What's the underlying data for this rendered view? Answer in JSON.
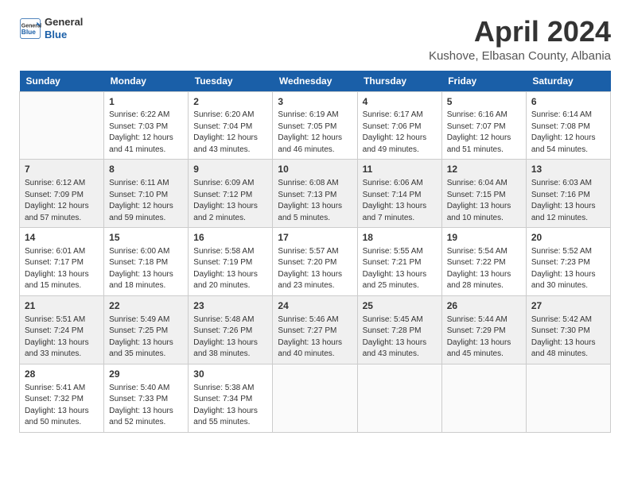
{
  "header": {
    "logo_line1": "General",
    "logo_line2": "Blue",
    "month_title": "April 2024",
    "subtitle": "Kushove, Elbasan County, Albania"
  },
  "weekdays": [
    "Sunday",
    "Monday",
    "Tuesday",
    "Wednesday",
    "Thursday",
    "Friday",
    "Saturday"
  ],
  "weeks": [
    [
      {
        "day": "",
        "info": ""
      },
      {
        "day": "1",
        "info": "Sunrise: 6:22 AM\nSunset: 7:03 PM\nDaylight: 12 hours\nand 41 minutes."
      },
      {
        "day": "2",
        "info": "Sunrise: 6:20 AM\nSunset: 7:04 PM\nDaylight: 12 hours\nand 43 minutes."
      },
      {
        "day": "3",
        "info": "Sunrise: 6:19 AM\nSunset: 7:05 PM\nDaylight: 12 hours\nand 46 minutes."
      },
      {
        "day": "4",
        "info": "Sunrise: 6:17 AM\nSunset: 7:06 PM\nDaylight: 12 hours\nand 49 minutes."
      },
      {
        "day": "5",
        "info": "Sunrise: 6:16 AM\nSunset: 7:07 PM\nDaylight: 12 hours\nand 51 minutes."
      },
      {
        "day": "6",
        "info": "Sunrise: 6:14 AM\nSunset: 7:08 PM\nDaylight: 12 hours\nand 54 minutes."
      }
    ],
    [
      {
        "day": "7",
        "info": "Sunrise: 6:12 AM\nSunset: 7:09 PM\nDaylight: 12 hours\nand 57 minutes."
      },
      {
        "day": "8",
        "info": "Sunrise: 6:11 AM\nSunset: 7:10 PM\nDaylight: 12 hours\nand 59 minutes."
      },
      {
        "day": "9",
        "info": "Sunrise: 6:09 AM\nSunset: 7:12 PM\nDaylight: 13 hours\nand 2 minutes."
      },
      {
        "day": "10",
        "info": "Sunrise: 6:08 AM\nSunset: 7:13 PM\nDaylight: 13 hours\nand 5 minutes."
      },
      {
        "day": "11",
        "info": "Sunrise: 6:06 AM\nSunset: 7:14 PM\nDaylight: 13 hours\nand 7 minutes."
      },
      {
        "day": "12",
        "info": "Sunrise: 6:04 AM\nSunset: 7:15 PM\nDaylight: 13 hours\nand 10 minutes."
      },
      {
        "day": "13",
        "info": "Sunrise: 6:03 AM\nSunset: 7:16 PM\nDaylight: 13 hours\nand 12 minutes."
      }
    ],
    [
      {
        "day": "14",
        "info": "Sunrise: 6:01 AM\nSunset: 7:17 PM\nDaylight: 13 hours\nand 15 minutes."
      },
      {
        "day": "15",
        "info": "Sunrise: 6:00 AM\nSunset: 7:18 PM\nDaylight: 13 hours\nand 18 minutes."
      },
      {
        "day": "16",
        "info": "Sunrise: 5:58 AM\nSunset: 7:19 PM\nDaylight: 13 hours\nand 20 minutes."
      },
      {
        "day": "17",
        "info": "Sunrise: 5:57 AM\nSunset: 7:20 PM\nDaylight: 13 hours\nand 23 minutes."
      },
      {
        "day": "18",
        "info": "Sunrise: 5:55 AM\nSunset: 7:21 PM\nDaylight: 13 hours\nand 25 minutes."
      },
      {
        "day": "19",
        "info": "Sunrise: 5:54 AM\nSunset: 7:22 PM\nDaylight: 13 hours\nand 28 minutes."
      },
      {
        "day": "20",
        "info": "Sunrise: 5:52 AM\nSunset: 7:23 PM\nDaylight: 13 hours\nand 30 minutes."
      }
    ],
    [
      {
        "day": "21",
        "info": "Sunrise: 5:51 AM\nSunset: 7:24 PM\nDaylight: 13 hours\nand 33 minutes."
      },
      {
        "day": "22",
        "info": "Sunrise: 5:49 AM\nSunset: 7:25 PM\nDaylight: 13 hours\nand 35 minutes."
      },
      {
        "day": "23",
        "info": "Sunrise: 5:48 AM\nSunset: 7:26 PM\nDaylight: 13 hours\nand 38 minutes."
      },
      {
        "day": "24",
        "info": "Sunrise: 5:46 AM\nSunset: 7:27 PM\nDaylight: 13 hours\nand 40 minutes."
      },
      {
        "day": "25",
        "info": "Sunrise: 5:45 AM\nSunset: 7:28 PM\nDaylight: 13 hours\nand 43 minutes."
      },
      {
        "day": "26",
        "info": "Sunrise: 5:44 AM\nSunset: 7:29 PM\nDaylight: 13 hours\nand 45 minutes."
      },
      {
        "day": "27",
        "info": "Sunrise: 5:42 AM\nSunset: 7:30 PM\nDaylight: 13 hours\nand 48 minutes."
      }
    ],
    [
      {
        "day": "28",
        "info": "Sunrise: 5:41 AM\nSunset: 7:32 PM\nDaylight: 13 hours\nand 50 minutes."
      },
      {
        "day": "29",
        "info": "Sunrise: 5:40 AM\nSunset: 7:33 PM\nDaylight: 13 hours\nand 52 minutes."
      },
      {
        "day": "30",
        "info": "Sunrise: 5:38 AM\nSunset: 7:34 PM\nDaylight: 13 hours\nand 55 minutes."
      },
      {
        "day": "",
        "info": ""
      },
      {
        "day": "",
        "info": ""
      },
      {
        "day": "",
        "info": ""
      },
      {
        "day": "",
        "info": ""
      }
    ]
  ]
}
